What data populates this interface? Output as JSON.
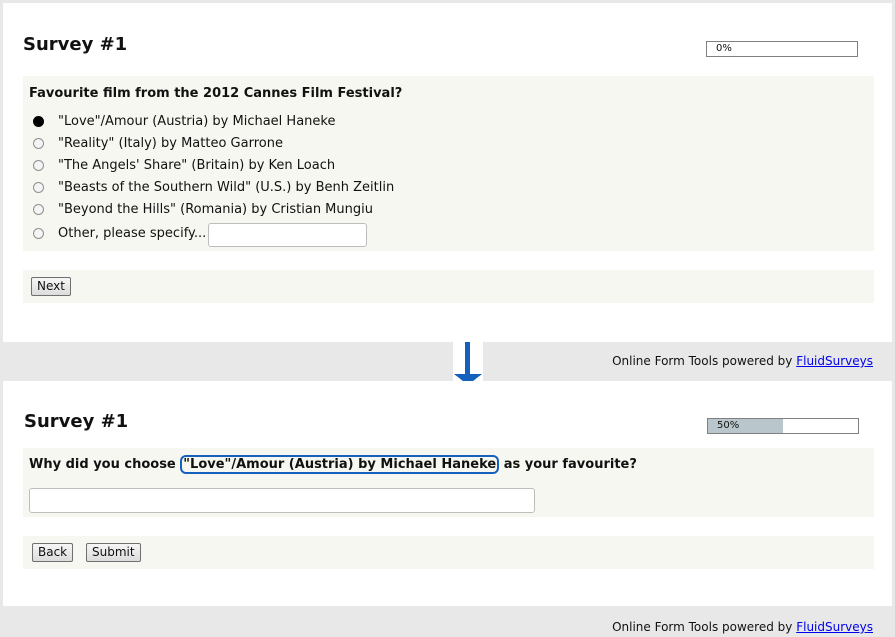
{
  "step1": {
    "title": "Survey #1",
    "progress": {
      "percent": 0,
      "label": "0%"
    },
    "question": "Favourite film from the 2012 Cannes Film Festival?",
    "options": [
      {
        "label": "\"Love\"/Amour (Austria) by Michael Haneke",
        "selected": true
      },
      {
        "label": "\"Reality\" (Italy) by Matteo Garrone",
        "selected": false
      },
      {
        "label": "\"The Angels' Share\" (Britain) by Ken Loach",
        "selected": false
      },
      {
        "label": "\"Beasts of the Southern Wild\" (U.S.) by Benh Zeitlin",
        "selected": false
      },
      {
        "label": "\"Beyond the Hills\" (Romania) by Cristian Mungiu",
        "selected": false
      },
      {
        "label": "Other, please specify...",
        "selected": false
      }
    ],
    "other_value": "",
    "next_label": "Next",
    "footer_text": "Online Form Tools powered by ",
    "footer_link": "FluidSurveys"
  },
  "step2": {
    "title": "Survey #1",
    "progress": {
      "percent": 50,
      "label": "50%"
    },
    "question_prefix": "Why did you choose ",
    "question_highlight": "\"Love\"/Amour (Austria) by Michael Haneke",
    "question_suffix": " as your favourite?",
    "answer_value": "",
    "back_label": "Back",
    "submit_label": "Submit",
    "footer_text": "Online Form Tools powered by ",
    "footer_link": "FluidSurveys"
  },
  "colors": {
    "accent": "#1560bd",
    "progress_fill": "#b9c6cc",
    "question_bg": "#f7f7f1"
  },
  "icons": {
    "transition": "arrow-down-icon"
  }
}
